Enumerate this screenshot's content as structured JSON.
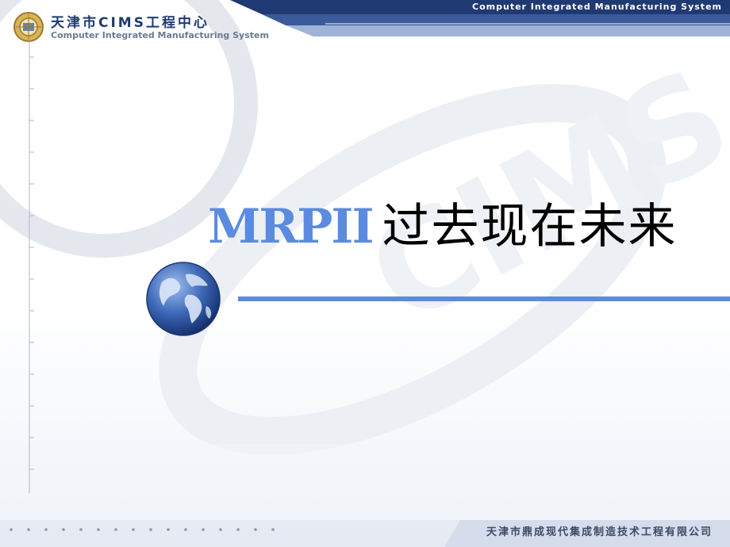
{
  "header": {
    "org_name": "天津市CIMS工程中心",
    "org_subtitle": "Computer Integrated Manufacturing System",
    "band_text": "Computer Integrated Manufacturing System"
  },
  "slide": {
    "title_en": "MRPII",
    "title_zh": "过去现在未来",
    "watermark_text": "CIMS"
  },
  "footer": {
    "company": "天津市鼎成现代集成制造技术工程有限公司"
  },
  "colors": {
    "navy": "#1f3a73",
    "accent_blue": "#5b8be0",
    "title_black": "#000000"
  },
  "icons": {
    "logo": "cims-logo-icon",
    "globe": "globe-icon"
  }
}
